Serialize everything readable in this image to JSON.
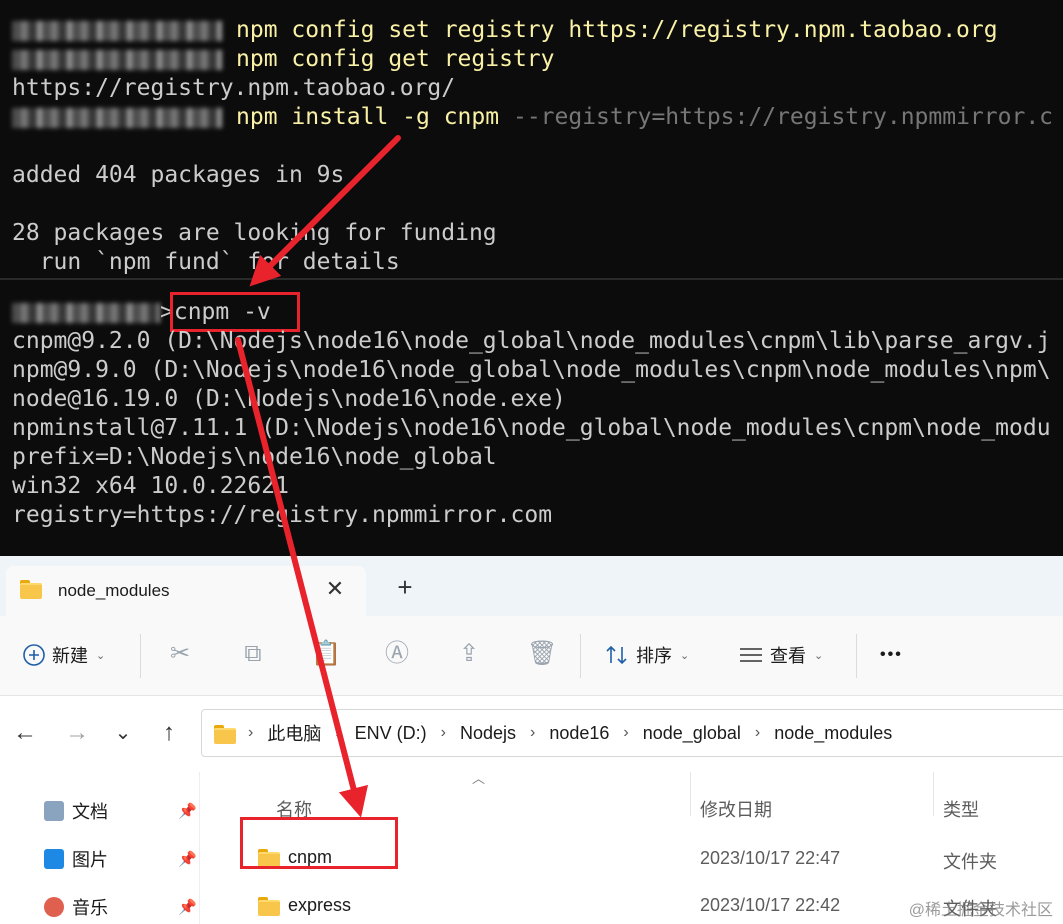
{
  "terminal_top": {
    "lines": [
      {
        "cmd": "npm config set registry https://registry.npm.taobao.org"
      },
      {
        "cmd": "npm config get registry"
      },
      {
        "text": "https://registry.npm.taobao.org/"
      },
      {
        "cmd": "npm install -g cnpm",
        "arg": "--registry=https://registry.npmmirror.c"
      },
      {
        "text": "added 404 packages in 9s"
      },
      {
        "text": "28 packages are looking for funding"
      },
      {
        "text": "  run `npm fund` for details"
      }
    ]
  },
  "terminal_bottom": {
    "command": ">cnpm -v",
    "lines": [
      "cnpm@9.2.0 (D:\\Nodejs\\node16\\node_global\\node_modules\\cnpm\\lib\\parse_argv.j",
      "npm@9.9.0 (D:\\Nodejs\\node16\\node_global\\node_modules\\cnpm\\node_modules\\npm\\",
      "node@16.19.0 (D:\\Nodejs\\node16\\node.exe)",
      "npminstall@7.11.1 (D:\\Nodejs\\node16\\node_global\\node_modules\\cnpm\\node_modu",
      "prefix=D:\\Nodejs\\node16\\node_global",
      "win32 x64 10.0.22621",
      "registry=https://registry.npmmirror.com"
    ]
  },
  "explorer": {
    "tab": {
      "label": "node_modules",
      "close": "✕",
      "add": "+"
    },
    "toolbar": {
      "new_label": "新建",
      "sort_label": "排序",
      "view_label": "查看",
      "more": "•••"
    },
    "nav": {
      "back": "←",
      "forward": "→",
      "recent": "⌄",
      "up": "↑"
    },
    "breadcrumb": [
      "此电脑",
      "ENV (D:)",
      "Nodejs",
      "node16",
      "node_global",
      "node_modules"
    ],
    "sidebar": [
      {
        "label": "文档",
        "icon": "documents-icon",
        "color": "#8aa4c0"
      },
      {
        "label": "图片",
        "icon": "pictures-icon",
        "color": "#1e88e5"
      },
      {
        "label": "音乐",
        "icon": "music-icon",
        "color": "#e0604f"
      }
    ],
    "columns": {
      "name": "名称",
      "date": "修改日期",
      "type": "类型"
    },
    "rows": [
      {
        "name": "cnpm",
        "date": "2023/10/17 22:47",
        "type": "文件夹"
      },
      {
        "name": "express",
        "date": "2023/10/17 22:42",
        "type": "文件夹"
      }
    ]
  },
  "watermark": "@稀土掘金技术社区",
  "colors": {
    "highlight": "#e8232b",
    "command": "#f9f1a5",
    "terminal_bg": "#0c0c0c"
  }
}
